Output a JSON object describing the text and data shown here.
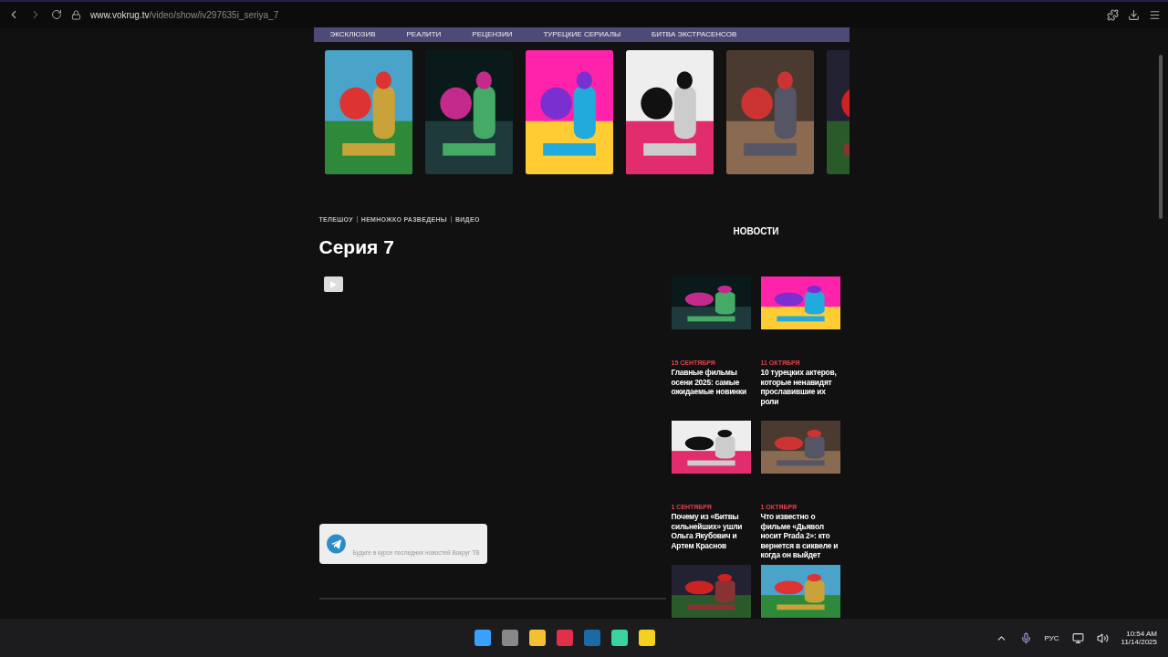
{
  "browser": {
    "url_host": "www.vokrug.tv",
    "url_path": "/video/show/iv297635i_seriya_7"
  },
  "nav": {
    "items": [
      "ЭКСКЛЮЗИВ",
      "РЕАЛИТИ",
      "РЕЦЕНЗИИ",
      "ТУРЕЦКИЕ СЕРИАЛЫ",
      "БИТВА ЭКСТРАСЕНСОВ"
    ]
  },
  "breadcrumbs": [
    "ТЕЛЕШОУ",
    "НЕМНОЖКО РАЗВЕДЕНЫ",
    "ВИДЕО"
  ],
  "title": "Серия 7",
  "telegram_card": {
    "text": "Будьте в курсе последних новостей Вокруг ТВ"
  },
  "news": {
    "heading": "НОВОСТИ",
    "items": [
      {
        "kind": "article",
        "date": "15 СЕНТЯБРЯ",
        "title": "Главные фильмы осени 2025: самые ожидаемые новинки"
      },
      {
        "kind": "article",
        "date": "11 ОКТЯБРЯ",
        "title": "10 турецких актеров, которые ненавидят прославившие их роли"
      },
      {
        "kind": "article",
        "date": "1 СЕНТЯБРЯ",
        "title": "Почему из «Битвы сильнейших» ушли Ольга Якубович и Артем Краснов"
      },
      {
        "kind": "article",
        "date": "1 ОКТЯБРЯ",
        "title": "Что известно о фильме «Дьявол носит Prada 2»: кто вернется в сиквеле и когда он выйдет"
      },
      {
        "kind": "picture_only"
      },
      {
        "kind": "picture_only"
      }
    ]
  },
  "taskbar": {
    "language": "РУС",
    "time": "10:54 AM",
    "date": "11/14/2025"
  }
}
